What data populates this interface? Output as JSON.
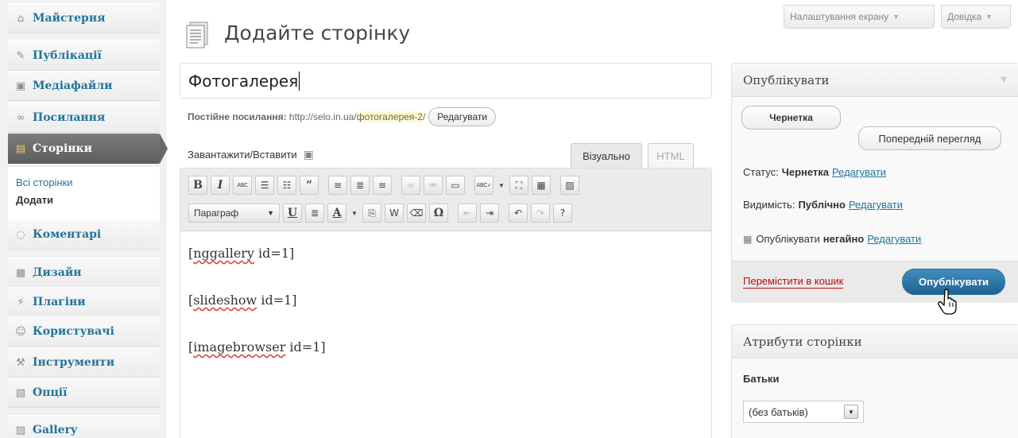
{
  "sidebar": {
    "items": [
      {
        "label": "Майстерня",
        "icon": "house-icon"
      },
      {
        "label": "Публікації",
        "icon": "pin-icon"
      },
      {
        "label": "Медіафайли",
        "icon": "media-icon"
      },
      {
        "label": "Посилання",
        "icon": "link-icon"
      },
      {
        "label": "Сторінки",
        "icon": "pages-icon"
      },
      {
        "label": "Коментарі",
        "icon": "comment-icon"
      },
      {
        "label": "Дизайн",
        "icon": "appearance-icon"
      },
      {
        "label": "Плагіни",
        "icon": "plugin-icon"
      },
      {
        "label": "Користувачі",
        "icon": "users-icon"
      },
      {
        "label": "Інструменти",
        "icon": "tools-icon"
      },
      {
        "label": "Опції",
        "icon": "settings-icon"
      },
      {
        "label": "Gallery",
        "icon": "gallery-icon"
      }
    ],
    "submenu": {
      "all_pages": "Всі сторінки",
      "add_new": "Додати"
    }
  },
  "header": {
    "title": "Додайте сторінку",
    "screen_options": "Налаштування екрану",
    "help": "Довідка"
  },
  "title_input": {
    "value": "Фотогалерея"
  },
  "permalink": {
    "label": "Постійне посилання:",
    "base": "http://selo.in.ua/",
    "slug": "фотогалерея-2",
    "suffix": "/",
    "edit": "Редагувати"
  },
  "editor": {
    "upload_label": "Завантажити/Вставити",
    "tab_visual": "Візуально",
    "tab_html": "HTML",
    "format": "Параграф",
    "content": [
      {
        "name": "nggallery",
        "rest": " id=1]"
      },
      {
        "name": "slideshow",
        "rest": " id=1]"
      },
      {
        "name": "imagebrowser",
        "rest": " id=1]"
      }
    ]
  },
  "publish": {
    "title": "Опублікувати",
    "save_draft": "Чернетка",
    "preview": "Попередній перегляд",
    "status_label": "Статус:",
    "status_value": "Чернетка",
    "visibility_label": "Видимість:",
    "visibility_value": "Публічно",
    "schedule_label": "Опублікувати",
    "schedule_value": "негайно",
    "edit": "Редагувати",
    "trash": "Перемістити в кошик",
    "publish_btn": "Опублікувати"
  },
  "attributes": {
    "title": "Атрибути сторінки",
    "parent_label": "Батьки",
    "parent_value": "(без батьків)"
  },
  "colors": {
    "link": "#21759b",
    "publish": "#21628f",
    "trash": "#bc0b0b",
    "slug_highlight": "#fffbcc"
  }
}
